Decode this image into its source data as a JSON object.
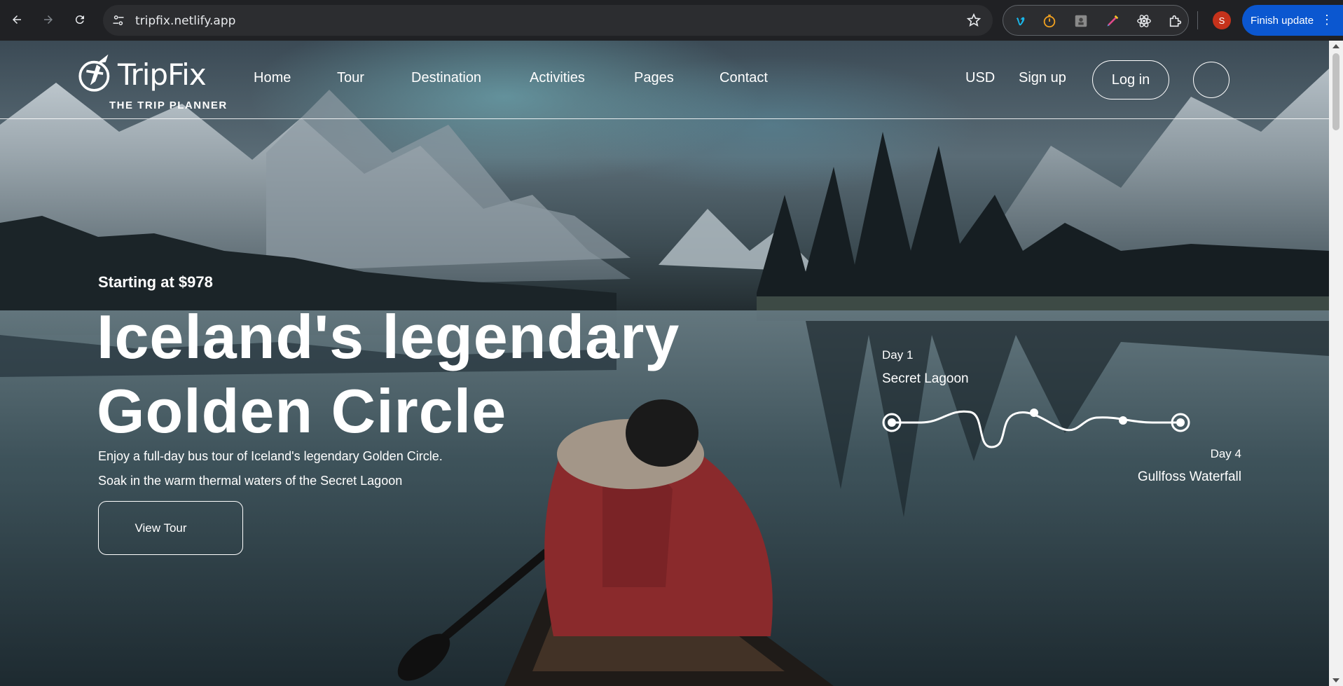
{
  "browser": {
    "url": "tripfix.netlify.app",
    "profile_initial": "S",
    "update_label": "Finish update",
    "extensions": [
      "vimeo-icon",
      "timer-icon",
      "app-icon",
      "color-picker-icon",
      "react-icon",
      "puzzle-icon"
    ]
  },
  "site": {
    "brand": "TripFix",
    "tagline": "THE TRIP PLANNER",
    "nav": [
      "Home",
      "Tour",
      "Destination",
      "Activities",
      "Pages",
      "Contact"
    ],
    "currency": "USD",
    "signup": "Sign up",
    "login": "Log in"
  },
  "hero": {
    "price": "Starting at $978",
    "headline_line1": "Iceland's legendary",
    "headline_line2": "Golden Circle",
    "desc_line1": "Enjoy a full-day bus tour of Iceland's legendary Golden Circle.",
    "desc_line2": "Soak in the warm thermal waters of the Secret Lagoon",
    "cta": "View Tour"
  },
  "itinerary": {
    "start_day": "Day 1",
    "start_place": "Secret Lagoon",
    "end_day": "Day 4",
    "end_place": "Gullfoss Waterfall"
  },
  "colors": {
    "chrome_bg": "#202124",
    "omnibox_bg": "#2c2d30",
    "update_button": "#0b57d0",
    "profile": "#c5321b"
  }
}
